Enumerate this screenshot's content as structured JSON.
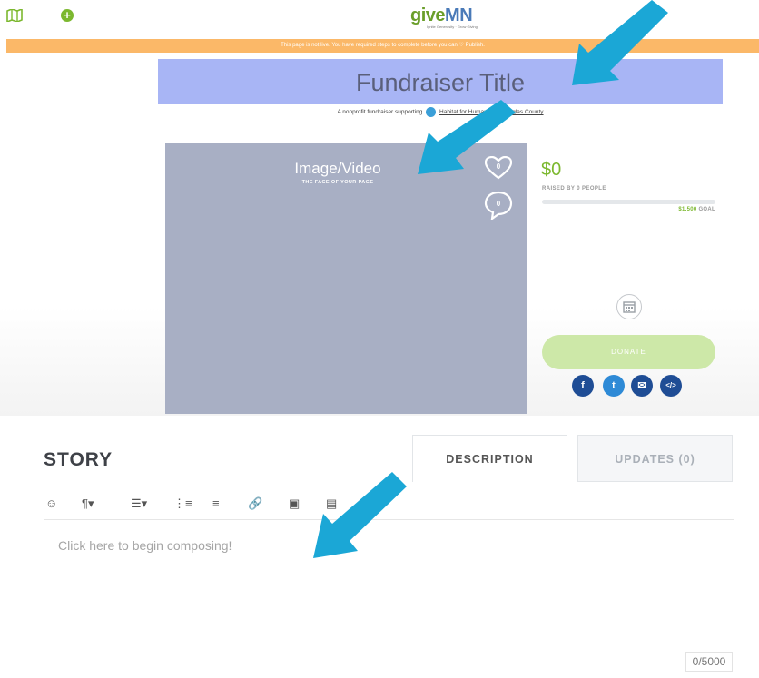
{
  "header": {
    "logo_give": "give",
    "logo_mn": "MN",
    "logo_tagline": "Ignite Generosity · Grow Giving"
  },
  "notice": "This page is not live. You have required steps to complete before you can ♡ Publish.",
  "fundraiser": {
    "title": "Fundraiser Title",
    "subline_prefix": "A nonprofit fundraiser supporting",
    "org_name": "Habitat for Humanity of Douglas County"
  },
  "media": {
    "title": "Image/Video",
    "subtitle": "THE FACE OF YOUR PAGE",
    "likes": "0",
    "comments": "0"
  },
  "stats": {
    "amount": "$0",
    "raised_text": "RAISED BY 0 PEOPLE",
    "progress": 0,
    "goal_amount": "$1,500",
    "goal_label": "GOAL"
  },
  "donate_label": "DONATE",
  "social": {
    "facebook": "f",
    "twitter": "t",
    "email": "✉",
    "code": "</>"
  },
  "story": {
    "heading": "STORY",
    "tabs": [
      "DESCRIPTION",
      "UPDATES (0)"
    ],
    "toolbar": [
      {
        "icon": "emoji-icon",
        "glyph": "☺"
      },
      {
        "icon": "paragraph-icon",
        "glyph": "¶▾"
      },
      {
        "icon": "align-icon",
        "glyph": "☰▾"
      },
      {
        "icon": "ordered-list-icon",
        "glyph": "⋮≡"
      },
      {
        "icon": "unordered-list-icon",
        "glyph": "≡"
      },
      {
        "icon": "link-icon",
        "glyph": "🔗"
      },
      {
        "icon": "image-icon",
        "glyph": "▣"
      },
      {
        "icon": "video-icon",
        "glyph": "▤"
      }
    ],
    "placeholder": "Click here to begin composing!",
    "counter": "0/5000"
  },
  "colors": {
    "accent_green": "#7cb82f",
    "arrow_blue": "#1ba7d6",
    "notice_orange": "#fbb868",
    "title_box": "#a8b5f5"
  }
}
